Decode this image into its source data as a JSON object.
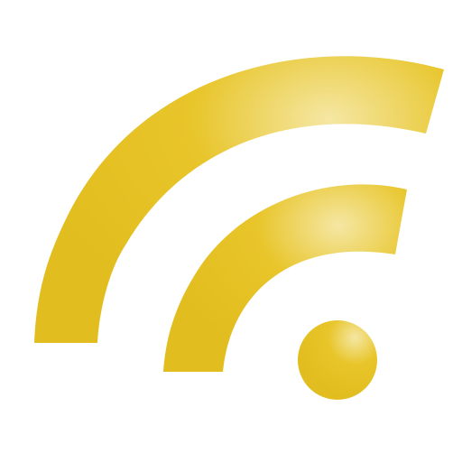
{
  "icon": {
    "name": "rss-feed-icon",
    "colors": {
      "base": "#e8c52a",
      "dark": "#e2bd1f",
      "highlight": "#f5e7a4",
      "background": "#ffffff"
    }
  }
}
